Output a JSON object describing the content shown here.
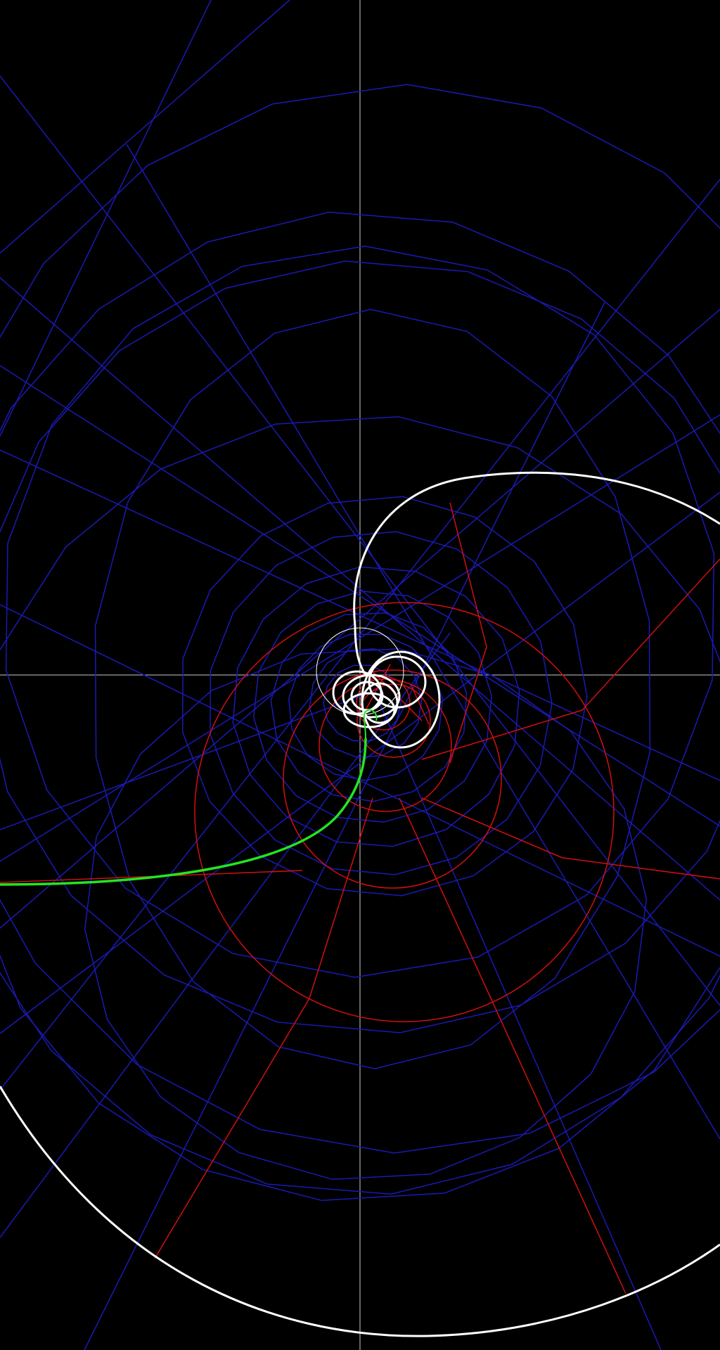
{
  "visualization": {
    "kind": "geometric-spiral-construction",
    "background_color": "#000000",
    "colors": {
      "axes": "#c8c8c8",
      "blue_construction": "#1a1ab4",
      "red_construction": "#d01010",
      "white_curve": "#ffffff",
      "green_curve": "#22e622"
    },
    "layers": [
      "axes",
      "blue-construction-polygons",
      "blue-construction-lines",
      "red-construction",
      "white-spiral",
      "green-curve"
    ]
  }
}
